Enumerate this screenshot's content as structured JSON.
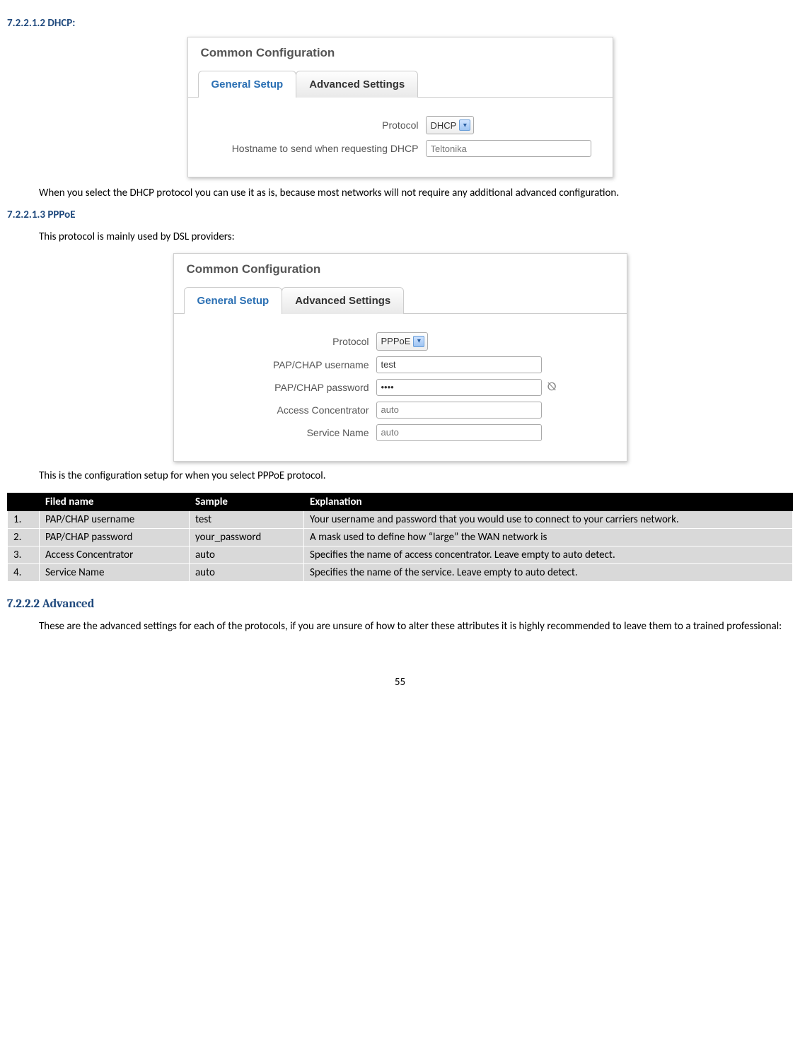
{
  "headings": {
    "dhcp": "7.2.2.1.2   DHCP:",
    "pppoe": "7.2.2.1.3   PPPoE",
    "advanced": "7.2.2.2    Advanced"
  },
  "panel1": {
    "title": "Common Configuration",
    "tab_active": "General Setup",
    "tab_inactive": "Advanced Settings",
    "protocol_label": "Protocol",
    "protocol_value": "DHCP",
    "hostname_label": "Hostname to send when requesting DHCP",
    "hostname_placeholder": "Teltonika"
  },
  "para_dhcp": "When you select the DHCP protocol you can use it as is, because most networks will not require any additional advanced configuration.",
  "para_pppoe_intro": "This protocol is mainly used by DSL providers:",
  "panel2": {
    "title": "Common Configuration",
    "tab_active": "General Setup",
    "tab_inactive": "Advanced Settings",
    "protocol_label": "Protocol",
    "protocol_value": "PPPoE",
    "user_label": "PAP/CHAP username",
    "user_value": "test",
    "pass_label": "PAP/CHAP password",
    "pass_value": "••••",
    "ac_label": "Access Concentrator",
    "ac_placeholder": "auto",
    "svc_label": "Service Name",
    "svc_placeholder": "auto"
  },
  "para_pppoe_caption": "This is the configuration setup for when you select PPPoE protocol.",
  "table": {
    "h_name": "Filed name",
    "h_sample": "Sample",
    "h_expl": "Explanation",
    "rows": [
      {
        "n": "1.",
        "name": "PAP/CHAP username",
        "sample": "test",
        "expl": "Your username and password that you would use to connect to your carriers network."
      },
      {
        "n": "2.",
        "name": "PAP/CHAP password",
        "sample": "your_password",
        "expl": "A mask used to define how “large” the WAN network is"
      },
      {
        "n": "3.",
        "name": "Access Concentrator",
        "sample": "auto",
        "expl": "Specifies the name of access concentrator. Leave empty to auto detect."
      },
      {
        "n": "4.",
        "name": "Service Name",
        "sample": "auto",
        "expl": "Specifies the name of the service. Leave empty to auto detect."
      }
    ]
  },
  "para_advanced": "These are the advanced settings for each of the protocols, if you are unsure of how to alter these attributes it is highly recommended to leave them to a trained professional:",
  "page_number": "55"
}
